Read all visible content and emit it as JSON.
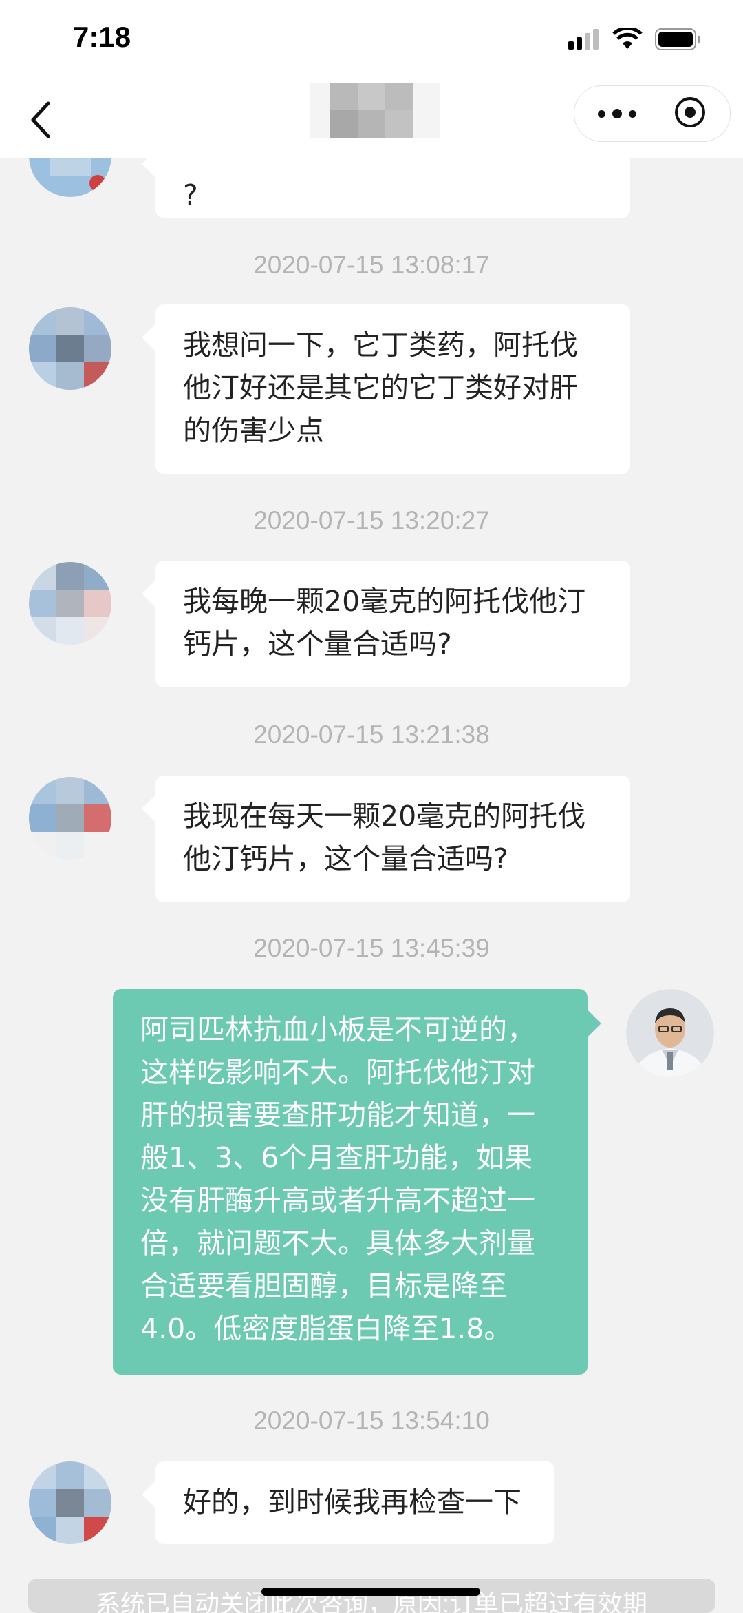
{
  "status": {
    "time": "7:18"
  },
  "nav": {
    "back_icon": "chevron-left-icon",
    "more_icon": "more-dots-icon",
    "close_icon": "target-icon"
  },
  "messages": [
    {
      "side": "left",
      "text": "?"
    },
    {
      "timestamp": "2020-07-15 13:08:17"
    },
    {
      "side": "left",
      "text": "我想问一下，它丁类药，阿托伐他汀好还是其它的它丁类好对肝的伤害少点"
    },
    {
      "timestamp": "2020-07-15 13:20:27"
    },
    {
      "side": "left",
      "text": "我每晚一颗20毫克的阿托伐他汀钙片，这个量合适吗?"
    },
    {
      "timestamp": "2020-07-15 13:21:38"
    },
    {
      "side": "left",
      "text": "我现在每天一颗20毫克的阿托伐他汀钙片，这个量合适吗?"
    },
    {
      "timestamp": "2020-07-15 13:45:39"
    },
    {
      "side": "right",
      "text": "阿司匹林抗血小板是不可逆的，这样吃影响不大。阿托伐他汀对肝的损害要查肝功能才知道，一般1、3、6个月查肝功能，如果没有肝酶升高或者升高不超过一倍，就问题不大。具体多大剂量合适要看胆固醇，目标是降至4.0。低密度脂蛋白降至1.8。"
    },
    {
      "timestamp": "2020-07-15 13:54:10"
    },
    {
      "side": "left",
      "text": "好的，到时候我再检查一下"
    }
  ],
  "system_notice": "系统已自动关闭此次咨询，原因:订单已超过有效期",
  "colors": {
    "doctor_bubble": "#6ccab3",
    "background": "#f2f2f2"
  }
}
